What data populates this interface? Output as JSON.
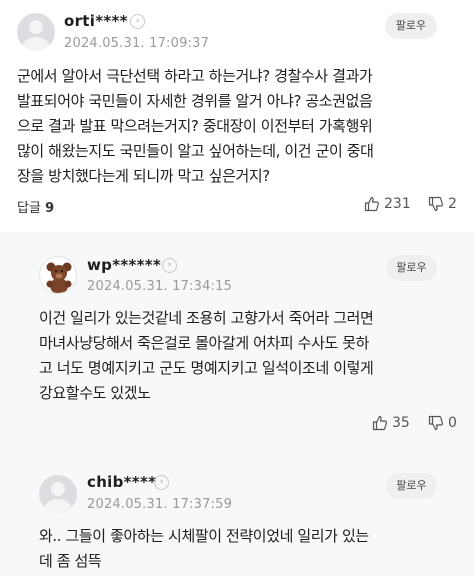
{
  "comments": [
    {
      "username": "orti****",
      "date": "2024.05.31. 17:09:37",
      "follow_label": "팔로우",
      "text": "군에서 알아서 극단선택 하라고 하는거냐? 경찰수사 결과가\n발표되어야 국민들이 자세한 경위를 알거 아냐? 공소권없음\n으로 결과 발표 막으려는거지? 중대장이 이전부터 가혹행위\n많이 해왔는지도 국민들이 알고 싶어하는데, 이건 군이 중대\n장을 방치했다는게 되니까 막고 싶은거지?",
      "reply_label": "답글",
      "reply_count": "9",
      "likes": "231",
      "dislikes": "2"
    }
  ],
  "replies": [
    {
      "username": "wp******",
      "date": "2024.05.31. 17:34:15",
      "follow_label": "팔로우",
      "text": "이건 일리가 있는것같네 조용히 고향가서 죽어라 그러면\n마녀사냥당해서 죽은걸로 몰아갈게 어차피 수사도 못하\n고 너도 명예지키고 군도 명예지키고 일석이조네 이렇게\n강요할수도 있겠노",
      "likes": "35",
      "dislikes": "0"
    },
    {
      "username": "chib****",
      "date": "2024.05.31. 17:37:59",
      "follow_label": "팔로우",
      "text": "와.. 그들이 좋아하는 시체팔이 전략이었네 일리가 있는\n데 좀 섬뜩"
    }
  ]
}
